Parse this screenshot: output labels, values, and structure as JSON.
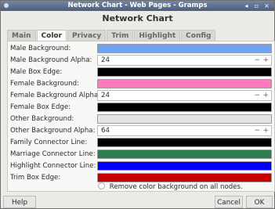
{
  "window": {
    "title": "Network Chart - Web Pages - Gramps",
    "heading": "Network Chart"
  },
  "tabs": [
    {
      "label": "Main"
    },
    {
      "label": "Color"
    },
    {
      "label": "Privacy"
    },
    {
      "label": "Trim"
    },
    {
      "label": "Highlight"
    },
    {
      "label": "Config"
    }
  ],
  "form": {
    "rows": [
      {
        "label": "Male Background:",
        "type": "color",
        "color": "#6fa3f2"
      },
      {
        "label": "Male Background Alpha:",
        "type": "spin",
        "value": "24"
      },
      {
        "label": "Male Box Edge:",
        "type": "color",
        "color": "#000000"
      },
      {
        "label": "Female Background:",
        "type": "color",
        "color": "#ff79bf"
      },
      {
        "label": "Female Background Alpha:",
        "type": "spin",
        "value": "24"
      },
      {
        "label": "Female Box Edge:",
        "type": "color",
        "color": "#000000"
      },
      {
        "label": "Other Background:",
        "type": "color",
        "color": "#e4e4e4"
      },
      {
        "label": "Other Background Alpha:",
        "type": "spin",
        "value": "64"
      },
      {
        "label": "Family Connector Line:",
        "type": "color",
        "color": "#000000"
      },
      {
        "label": "Marriage Connector Line:",
        "type": "color",
        "color": "#2d7e50"
      },
      {
        "label": "Highlight Connector Line:",
        "type": "color",
        "color": "#0000ff"
      },
      {
        "label": "Trim Box Edge:",
        "type": "color",
        "color": "#c50000"
      }
    ],
    "checkbox_label": "Remove color background on all nodes."
  },
  "buttons": {
    "help": "Help",
    "cancel": "Cancel",
    "ok": "OK"
  },
  "spin_symbols": {
    "minus": "−",
    "plus": "+"
  },
  "titlebar_symbols": {
    "min": "◂",
    "max": "▫",
    "close": "×"
  }
}
